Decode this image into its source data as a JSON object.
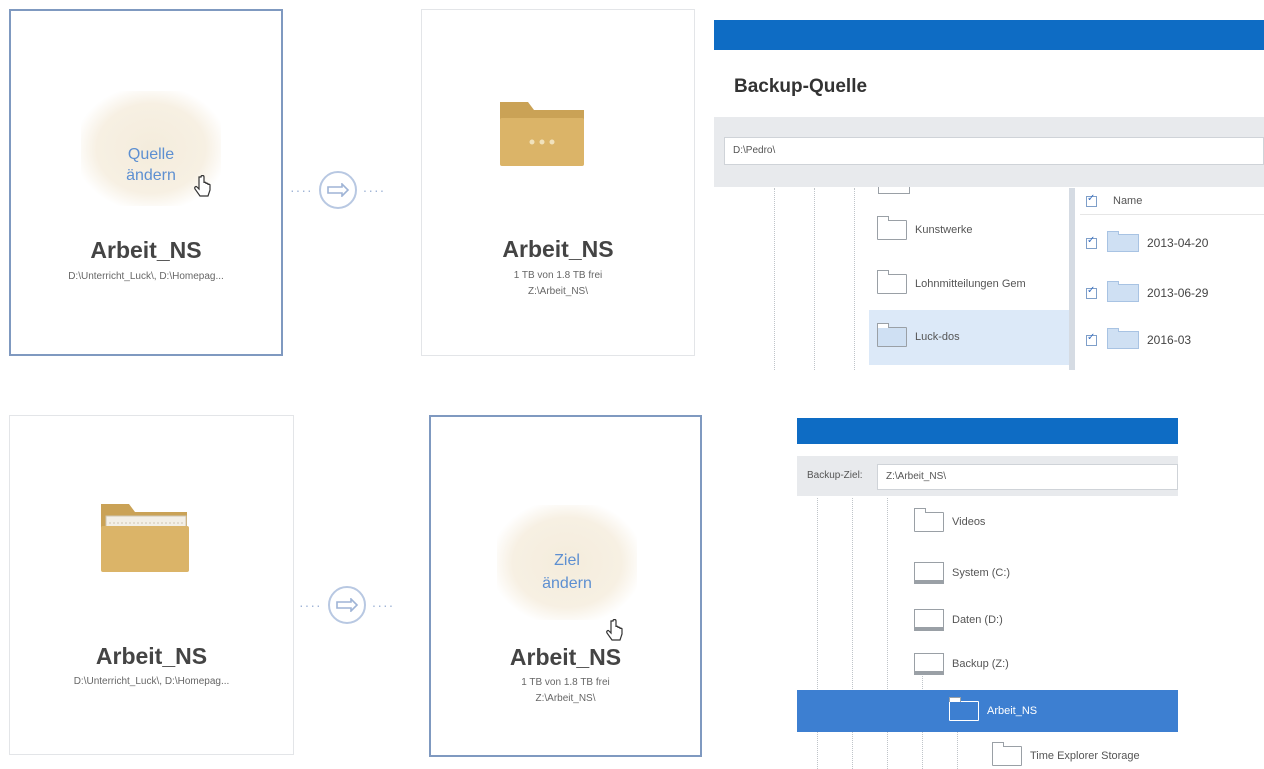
{
  "top_row": {
    "source_card": {
      "hover_label_line1": "Quelle",
      "hover_label_line2": "ändern",
      "name": "Arbeit_NS",
      "path": "D:\\Unterricht_Luck\\, D:\\Homepag..."
    },
    "dest_card": {
      "name": "Arbeit_NS",
      "capacity": "1 TB von 1.8 TB frei",
      "path": "Z:\\Arbeit_NS\\"
    }
  },
  "bottom_row": {
    "source_card": {
      "name": "Arbeit_NS",
      "path": "D:\\Unterricht_Luck\\, D:\\Homepag..."
    },
    "dest_card": {
      "hover_label_line1": "Ziel",
      "hover_label_line2": "ändern",
      "name": "Arbeit_NS",
      "capacity": "1 TB von 1.8 TB frei",
      "path": "Z:\\Arbeit_NS\\"
    }
  },
  "source_panel": {
    "title": "Backup-Quelle",
    "path_value": "D:\\Pedro\\",
    "tree_items": [
      "Kunstwerke",
      "Lohnmitteilungen Gem",
      "Luck-dos"
    ],
    "list_header": "Name",
    "list_items": [
      "2013-04-20",
      "2013-06-29",
      "2016-03"
    ]
  },
  "dest_panel": {
    "label": "Backup-Ziel:",
    "path_value": "Z:\\Arbeit_NS\\",
    "tree_items": [
      {
        "label": "Videos",
        "type": "folder"
      },
      {
        "label": "System (C:)",
        "type": "drive"
      },
      {
        "label": "Daten (D:)",
        "type": "drive"
      },
      {
        "label": "Backup (Z:)",
        "type": "drive"
      },
      {
        "label": "Arbeit_NS",
        "type": "folder",
        "selected": true
      },
      {
        "label": "Time Explorer Storage",
        "type": "folder"
      }
    ]
  },
  "colors": {
    "accent": "#0e6cc4",
    "selection": "#3d7fd1",
    "folder": "#dbb468",
    "hover_text": "#5d8fd1"
  }
}
